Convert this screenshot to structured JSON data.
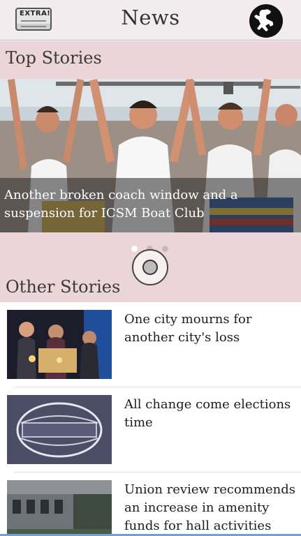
{
  "header": {
    "title": "News",
    "left_icon_text": "EXTRA!",
    "left_icon": "newspaper-icon",
    "right_icon": "mascot-avatar"
  },
  "top_stories": {
    "title": "Top Stories",
    "hero_caption": "Another broken coach window and a suspension for ICSM Boat Club",
    "carousel_active_index": 0,
    "carousel_count": 3
  },
  "other_stories": {
    "title": "Other Stories",
    "items": [
      {
        "headline": "One city mourns for another city's loss"
      },
      {
        "headline": "All change come elections time"
      },
      {
        "headline": "Union review recommends an increase in amenity funds for hall activities"
      }
    ]
  },
  "colors": {
    "section_background": "#ecd5d8",
    "header_background": "#f3ecee"
  }
}
